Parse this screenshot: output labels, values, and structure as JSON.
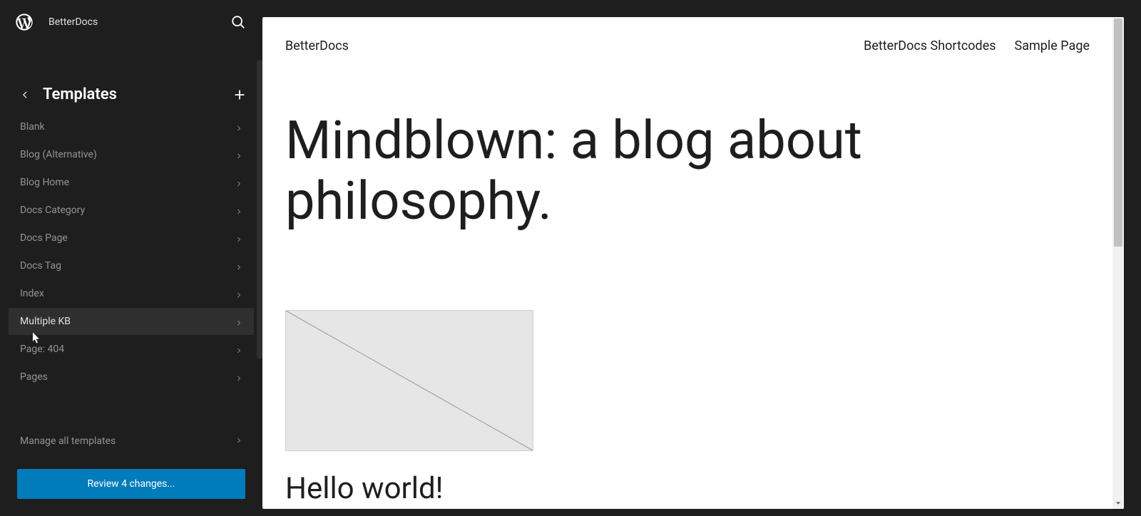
{
  "header": {
    "site_name": "BetterDocs"
  },
  "section": {
    "title": "Templates"
  },
  "templates": {
    "items": [
      {
        "label": "Blank"
      },
      {
        "label": "Blog (Alternative)"
      },
      {
        "label": "Blog Home"
      },
      {
        "label": "Docs Category"
      },
      {
        "label": "Docs Page"
      },
      {
        "label": "Docs Tag"
      },
      {
        "label": "Index"
      },
      {
        "label": "Multiple KB"
      },
      {
        "label": "Page: 404"
      },
      {
        "label": "Pages"
      }
    ],
    "manage_all": "Manage all templates"
  },
  "review": {
    "button_label": "Review 4 changes..."
  },
  "preview": {
    "site_title": "BetterDocs",
    "nav": [
      {
        "label": "BetterDocs Shortcodes"
      },
      {
        "label": "Sample Page"
      }
    ],
    "heading": "Mindblown: a blog about philosophy.",
    "post_title": "Hello world!"
  }
}
